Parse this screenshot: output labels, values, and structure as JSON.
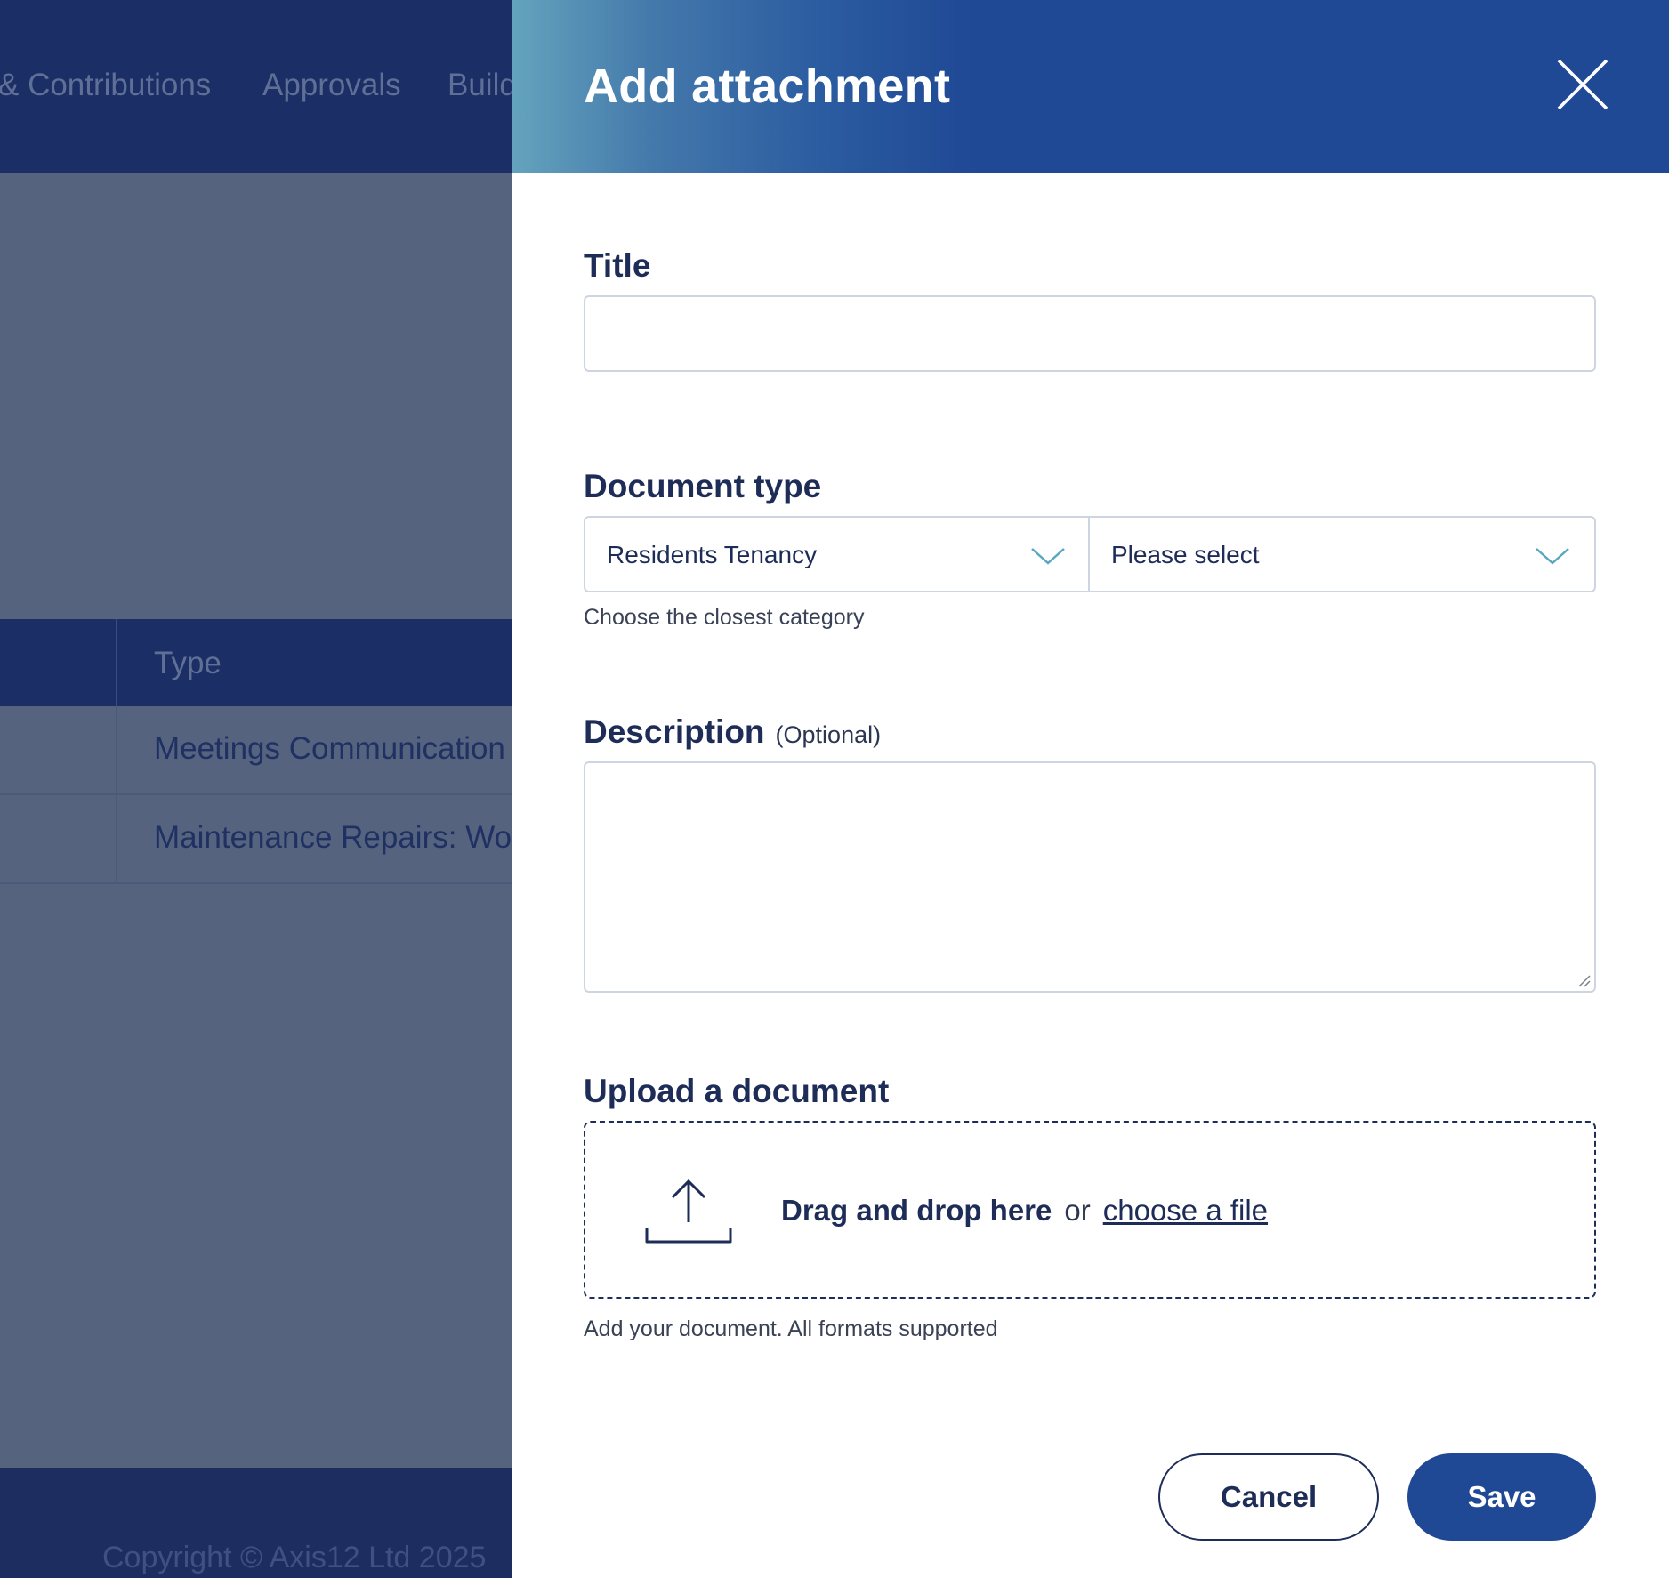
{
  "background": {
    "nav_items": [
      "& Contributions",
      "Approvals",
      "Build"
    ],
    "table": {
      "header": "Type",
      "rows": [
        "Meetings Communication",
        "Maintenance Repairs: Wo"
      ]
    },
    "footer_copyright": "Copyright © Axis12 Ltd 2025"
  },
  "drawer": {
    "title": "Add attachment",
    "close_icon": "close-icon",
    "title_field": {
      "label": "Title",
      "value": "",
      "placeholder": ""
    },
    "document_type": {
      "label": "Document type",
      "primary_value": "Residents Tenancy",
      "secondary_value": "Please select",
      "hint": "Choose the closest category"
    },
    "description": {
      "label": "Description",
      "optional": "(Optional)",
      "value": ""
    },
    "upload": {
      "label": "Upload a document",
      "drag_text": "Drag and drop here",
      "or_text": "or",
      "choose_link": "choose a file",
      "hint": "Add your document. All formats supported",
      "icon": "upload-icon"
    },
    "buttons": {
      "cancel": "Cancel",
      "save": "Save"
    }
  },
  "colors": {
    "primary": "#1f4895",
    "text_dark": "#1e2c58",
    "header_gradient_start": "#64a3bd",
    "chevron": "#5aa7c0",
    "overlay": "#55637f"
  }
}
